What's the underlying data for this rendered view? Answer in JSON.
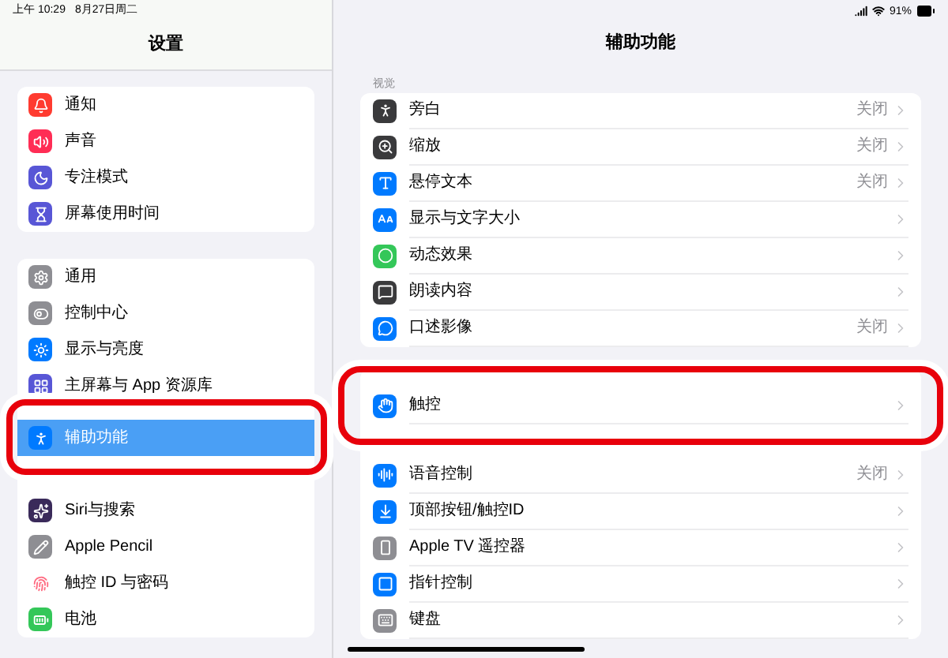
{
  "status_bar": {
    "time": "上午 10:29",
    "date": "8月27日周二",
    "battery": "91%"
  },
  "sidebar": {
    "title": "设置",
    "groups": [
      {
        "items": [
          {
            "label": "通知",
            "color": "#ff3b30",
            "selected": false,
            "callout": false
          },
          {
            "label": "声音",
            "color": "#ff2d55",
            "selected": false,
            "callout": false
          },
          {
            "label": "专注模式",
            "color": "#5856d6",
            "selected": false,
            "callout": false
          },
          {
            "label": "屏幕使用时间",
            "color": "#5856d6",
            "selected": false,
            "callout": false
          }
        ]
      },
      {
        "items": [
          {
            "label": "通用",
            "color": "#8e8e93",
            "selected": false,
            "callout": false
          },
          {
            "label": "控制中心",
            "color": "#8e8e93",
            "selected": false,
            "callout": false
          },
          {
            "label": "显示与亮度",
            "color": "#007aff",
            "selected": false,
            "callout": false
          },
          {
            "label": "主屏幕与 App 资源库",
            "color": "#5856d6",
            "selected": false,
            "callout": false
          },
          {
            "label": "辅助功能",
            "color": "#007aff",
            "selected": true,
            "callout": true
          },
          {
            "label": "Siri与搜索",
            "color": "#3a2a5a",
            "selected": false,
            "callout": false
          },
          {
            "label": "Apple Pencil",
            "color": "#8e8e93",
            "selected": false,
            "callout": false
          },
          {
            "label": "触控 ID 与密码",
            "color": "#ffffff",
            "selected": false,
            "callout": false
          },
          {
            "label": "电池",
            "color": "#34c759",
            "selected": false,
            "callout": false
          }
        ]
      }
    ]
  },
  "detail": {
    "title": "辅助功能",
    "sections": [
      {
        "header": "视觉",
        "items": [
          {
            "label": "旁白",
            "value": "关闭",
            "color": "#3a3a3c",
            "callout": false
          },
          {
            "label": "缩放",
            "value": "关闭",
            "color": "#3a3a3c",
            "callout": false
          },
          {
            "label": "悬停文本",
            "value": "关闭",
            "color": "#007aff",
            "callout": false
          },
          {
            "label": "显示与文字大小",
            "color": "#007aff",
            "callout": false
          },
          {
            "label": "动态效果",
            "color": "#34c759",
            "callout": false
          },
          {
            "label": "朗读内容",
            "color": "#3a3a3c",
            "callout": false
          },
          {
            "label": "口述影像",
            "value": "关闭",
            "color": "#007aff",
            "callout": false
          }
        ]
      },
      {
        "items": [
          {
            "label": "触控",
            "color": "#007aff",
            "callout": true
          },
          {
            "label": "语音控制",
            "value": "关闭",
            "color": "#007aff",
            "callout": false
          },
          {
            "label": "顶部按钮/触控ID",
            "color": "#007aff",
            "callout": false
          },
          {
            "label": "Apple TV 遥控器",
            "color": "#8e8e93",
            "callout": false
          },
          {
            "label": "指针控制",
            "color": "#007aff",
            "callout": false
          },
          {
            "label": "键盘",
            "color": "#8e8e93",
            "callout": false
          }
        ]
      }
    ]
  }
}
